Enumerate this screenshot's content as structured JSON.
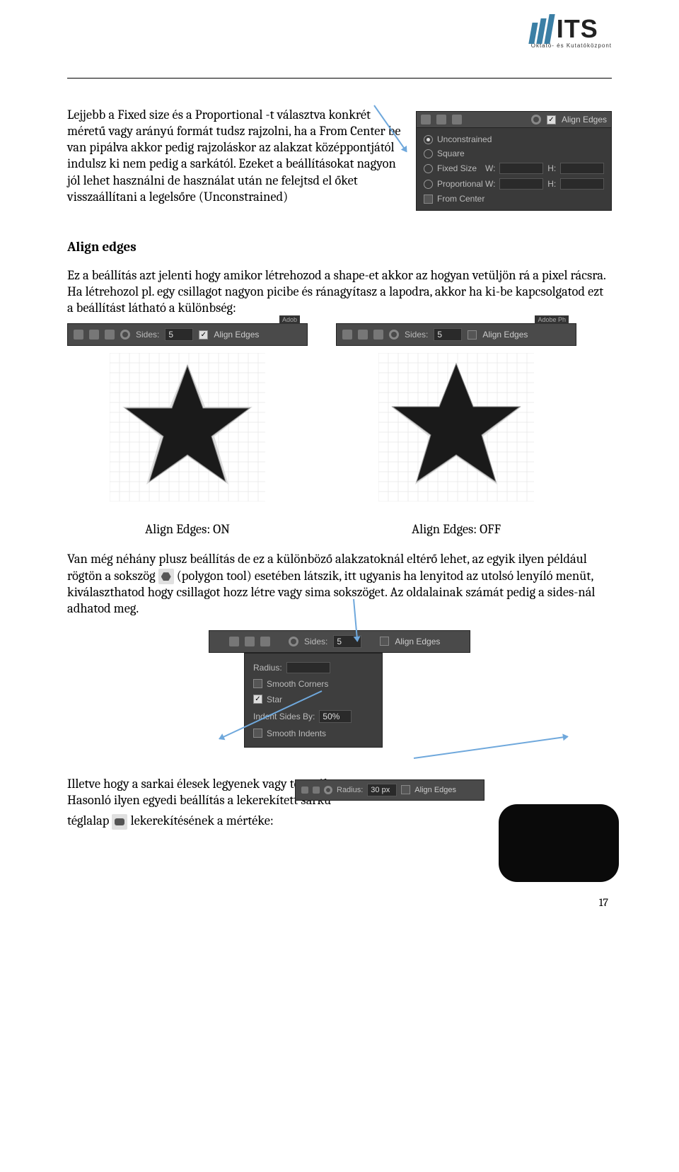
{
  "logo": {
    "text": "ITS",
    "sub": "Oktató- és Kutatóközpont"
  },
  "para1": "Lejjebb a Fixed size és a Proportional -t választva konkrét méretű vagy arányú formát tudsz rajzolni, ha a From Center be van pipálva akkor pedig rajzoláskor az alakzat középpontjától indulsz ki nem pedig a sarkától. Ezeket a beállításokat nagyon jól lehet használni de használat után ne felejtsd el őket visszaállítani a legelsőre (Unconstrained)",
  "heading1": "Align edges",
  "para2": "Ez a beállítás azt jelenti hogy amikor létrehozod a shape-et akkor az hogyan vetüljön rá a pixel rácsra. Ha létrehozol pl. egy csillagot nagyon picibe és ránagyítasz a lapodra, akkor ha ki-be kapcsolgatod ezt a beállítást látható a különbség:",
  "ps_panel": {
    "align_edges": "Align Edges",
    "rows": [
      {
        "label": "Unconstrained",
        "sel": true
      },
      {
        "label": "Square",
        "sel": false
      },
      {
        "label": "Fixed Size",
        "sel": false,
        "w": "W:",
        "h": "H:"
      },
      {
        "label": "Proportional",
        "sel": false,
        "w": "W:",
        "h": "H:"
      }
    ],
    "from_center": "From Center"
  },
  "optbar": {
    "sides_label": "Sides:",
    "sides_value": "5",
    "align_edges": "Align Edges",
    "hint": "Adobe Ph"
  },
  "captions": {
    "on": "Align Edges: ON",
    "off": "Align Edges: OFF"
  },
  "para3_a": "Van még néhány plusz beállítás de ez a különböző alakzatoknál eltérő lehet, az egyik ilyen például rögtön a sokszög",
  "para3_b": " (polygon tool) esetében látszik, itt ugyanis ha lenyitod az utolsó lenyíló menüt, kiválaszthatod hogy csillagot hozz létre vagy sima sokszöget. Az oldalainak számát pedig a sides-nál adhatod meg.",
  "poly_drop": {
    "radius": "Radius:",
    "smooth_corners": "Smooth Corners",
    "star": "Star",
    "indent": "Indent Sides By:",
    "indent_val": "50%",
    "smooth_indents": "Smooth Indents"
  },
  "radius_bar": {
    "label": "Radius:",
    "value": "30 px",
    "align_edges": "Align Edges"
  },
  "para4_a": "Illetve hogy a sarkai élesek legyenek vagy tompák",
  "para4_b": "Hasonló ilyen egyedi beállítás a lekerekített sarkú",
  "para4_c_a": "téglalap",
  "para4_c_b": "lekerekítésének a mértéke:",
  "page_number": "17"
}
